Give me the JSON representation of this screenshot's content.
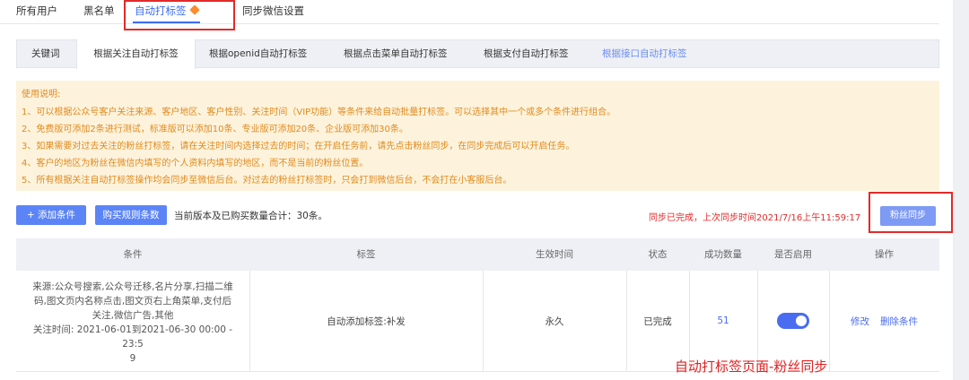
{
  "top_tabs": [
    {
      "label": "所有用户"
    },
    {
      "label": "黑名单"
    },
    {
      "label": "自动打标签"
    },
    {
      "label": "同步微信设置"
    }
  ],
  "sub_tabs": [
    {
      "label": "关键词"
    },
    {
      "label": "根据关注自动打标签"
    },
    {
      "label": "根据openid自动打标签"
    },
    {
      "label": "根据点击菜单自动打标签"
    },
    {
      "label": "根据支付自动打标签"
    },
    {
      "label": "根据接口自动打标签"
    }
  ],
  "notice": {
    "title": "使用说明:",
    "lines": [
      "1、可以根据公众号客户关注来源、客户地区、客户性别、关注时间（VIP功能）等条件来给自动批量打标签。可以选择其中一个或多个条件进行组合。",
      "2、免费版可添加2条进行测试，标准版可以添加10条、专业版可添加20条、企业版可添加30条。",
      "3、如果需要对过去关注的粉丝打标签，请在关注时间内选择过去的时间；在开启任务前，请先点击粉丝同步，在同步完成后可以开启任务。",
      "4、客户的地区为粉丝在微信内填写的个人资料内填写的地区，而不是当前的粉丝位置。",
      "5、所有根据关注自动打标签操作均会同步至微信后台。对过去的粉丝打标签时，只会打到微信后台，不会打在小客服后台。"
    ]
  },
  "actions": {
    "add_label": "+ 添加条件",
    "buy_label": "购买规则条数",
    "count_text": "当前版本及已购买数量合计：30条。",
    "sync_status": "同步已完成，上次同步时间2021/7/16上午11:59:17",
    "sync_label": "粉丝同步"
  },
  "table": {
    "headers": [
      "条件",
      "标签",
      "生效时间",
      "状态",
      "成功数量",
      "是否启用",
      "操作"
    ],
    "row": {
      "condition_lines": [
        "来源:公众号搜索,公众号迁移,名片分享,扫描二维",
        "码,图文页内名称点击,图文页右上角菜单,支付后",
        "关注,微信广告,其他",
        "关注时间: 2021-06-01到2021-06-30 00:00 - 23:5",
        "9"
      ],
      "tag": "自动添加标签:补发",
      "effective": "永久",
      "status": "已完成",
      "success_count": "51",
      "enabled": true,
      "op_edit": "修改",
      "op_delete": "删除条件"
    }
  },
  "caption": "自动打标签页面-粉丝同步",
  "colors": {
    "accent": "#3b6cf5",
    "button": "#5b84f7",
    "notice_bg": "#fdf3dc",
    "notice_text": "#e08a1e",
    "highlight_red": "#e32a2a"
  }
}
